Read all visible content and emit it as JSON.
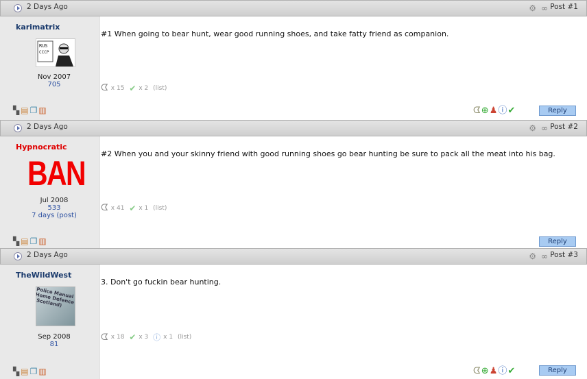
{
  "posts": [
    {
      "date": "2 Days Ago",
      "post_no": "Post #1",
      "username": "karimatrix",
      "username_color": "#1a3a6c",
      "join_date": "Nov 2007",
      "post_count": "705",
      "extra": "",
      "message": "#1 When going to bear hunt, wear good running shoes, and take fatty friend as companion.",
      "thanks": [
        "x 15",
        "x 2",
        "(list)"
      ],
      "reply": "Reply"
    },
    {
      "date": "2 Days Ago",
      "post_no": "Post #2",
      "username": "Hypnocratic",
      "username_color": "#e00000",
      "join_date": "Jul 2008",
      "post_count": "533",
      "extra": "7 days (post)",
      "avatar_text": "BAN",
      "message": "#2 When you and your skinny friend with good running shoes go bear hunting be sure to pack all the meat into his bag.",
      "thanks": [
        "x 41",
        "x 1",
        "(list)"
      ],
      "reply": "Reply"
    },
    {
      "date": "2 Days Ago",
      "post_no": "Post #3",
      "username": "TheWildWest",
      "username_color": "#1a3a6c",
      "join_date": "Sep 2008",
      "post_count": "81",
      "extra": "",
      "avatar_text": "Police Manual Home Defence (Scotland)",
      "message": "3. Don't go fuckin bear hunting.",
      "thanks": [
        "x 18",
        "x 3",
        "x 1",
        "(list)"
      ],
      "reply": "Reply"
    }
  ]
}
